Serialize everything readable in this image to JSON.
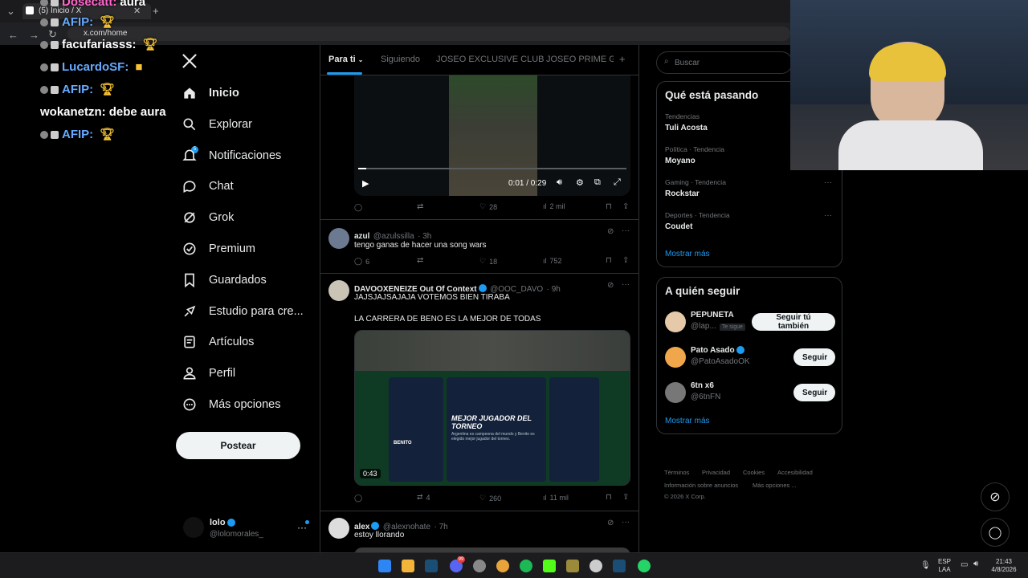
{
  "browser": {
    "tab_title": "(5) Inicio / X",
    "url": "x.com/home"
  },
  "stream_chat": [
    {
      "user": "Dosecatt:",
      "message": "aura",
      "color": "#ff66cc"
    },
    {
      "user": "AFIP:",
      "message": "",
      "color": "#66aaff"
    },
    {
      "user": "facufariasss:",
      "message": "",
      "color": "#ffffff"
    },
    {
      "user": "LucardoSF:",
      "message": "",
      "color": "#66aaff"
    },
    {
      "user": "AFIP:",
      "message": "",
      "color": "#66aaff"
    },
    {
      "user": "wokanetzn:",
      "message": "debe aura",
      "color": "#ffffff"
    },
    {
      "user": "AFIP:",
      "message": "",
      "color": "#66aaff"
    }
  ],
  "nav": {
    "items": [
      {
        "label": "Inicio",
        "icon": "home-icon"
      },
      {
        "label": "Explorar",
        "icon": "search-icon"
      },
      {
        "label": "Notificaciones",
        "icon": "bell-icon"
      },
      {
        "label": "Chat",
        "icon": "chat-icon"
      },
      {
        "label": "Grok",
        "icon": "grok-icon"
      },
      {
        "label": "Premium",
        "icon": "premium-icon"
      },
      {
        "label": "Guardados",
        "icon": "bookmark-icon"
      },
      {
        "label": "Estudio para cre...",
        "icon": "rocket-icon"
      },
      {
        "label": "Artículos",
        "icon": "article-icon"
      },
      {
        "label": "Perfil",
        "icon": "person-icon"
      },
      {
        "label": "Más opciones",
        "icon": "more-circle-icon"
      }
    ],
    "notif_count": "5",
    "post_label": "Postear",
    "account": {
      "name": "lolo",
      "handle": "@lolomorales_"
    }
  },
  "feed": {
    "tabs": [
      "Para ti",
      "Siguiendo",
      "JOSEO EXCLUSIVE CLUB",
      "JOSEO PRIME GR"
    ],
    "video_top": {
      "time": "0:01 / 0:29",
      "replies": "",
      "reposts": "",
      "likes": "28",
      "views": "2 mil"
    },
    "tweets": [
      {
        "name": "azul",
        "handle": "@azulssilla",
        "time": "· 3h",
        "text": "tengo ganas de hacer una song wars",
        "replies": "6",
        "reposts": "",
        "likes": "18",
        "views": "752"
      },
      {
        "name": "DAVOOXENEIZE Out Of Context",
        "handle": "@OOC_DAVO",
        "time": "· 9h",
        "text1": "JAJSJAJSAJAJA VOTEMOS BIEN TIRABA",
        "text2": "LA CARRERA DE BENO ES LA MEJOR DE TODAS",
        "media_title": "MEJOR JUGADOR DEL TORNEO",
        "media_sub": "Argentina es campeona del mundo y Benito es elegido mejor jugador del torneo.",
        "media_duration": "0:43",
        "media_player": "BENITO",
        "replies": "",
        "reposts": "4",
        "likes": "260",
        "views": "11 mil"
      },
      {
        "name": "alex",
        "handle": "@alexnohate",
        "time": "· 7h",
        "text": "estoy llorando"
      }
    ]
  },
  "right": {
    "search_placeholder": "Buscar",
    "trends_title": "Qué está pasando",
    "trends": [
      {
        "meta": "Tendencias",
        "name": "Tuli Acosta"
      },
      {
        "meta": "Política · Tendencia",
        "name": "Moyano"
      },
      {
        "meta": "Gaming · Tendencia",
        "name": "Rockstar"
      },
      {
        "meta": "Deportes · Tendencia",
        "name": "Coudet"
      }
    ],
    "show_more": "Mostrar más",
    "follow_title": "A quién seguir",
    "follow": [
      {
        "name": "PEPUNETA",
        "handle": "@lap...",
        "tag": "Te sigue",
        "button": "Seguir tú también"
      },
      {
        "name": "Pato Asado",
        "handle": "@PatoAsadoOK",
        "tag": "",
        "button": "Seguir"
      },
      {
        "name": "6tn x6",
        "handle": "@6tnFN",
        "tag": "",
        "button": "Seguir"
      }
    ],
    "footer": [
      "Términos",
      "Privacidad",
      "Cookies",
      "Accesibilidad",
      "Información sobre anuncios",
      "Más opciones ...",
      "© 2026 X Corp."
    ]
  },
  "taskbar": {
    "lang1": "ESP",
    "lang2": "LAA",
    "time": "21:43",
    "date": "4/8/2026",
    "badge": "99"
  }
}
